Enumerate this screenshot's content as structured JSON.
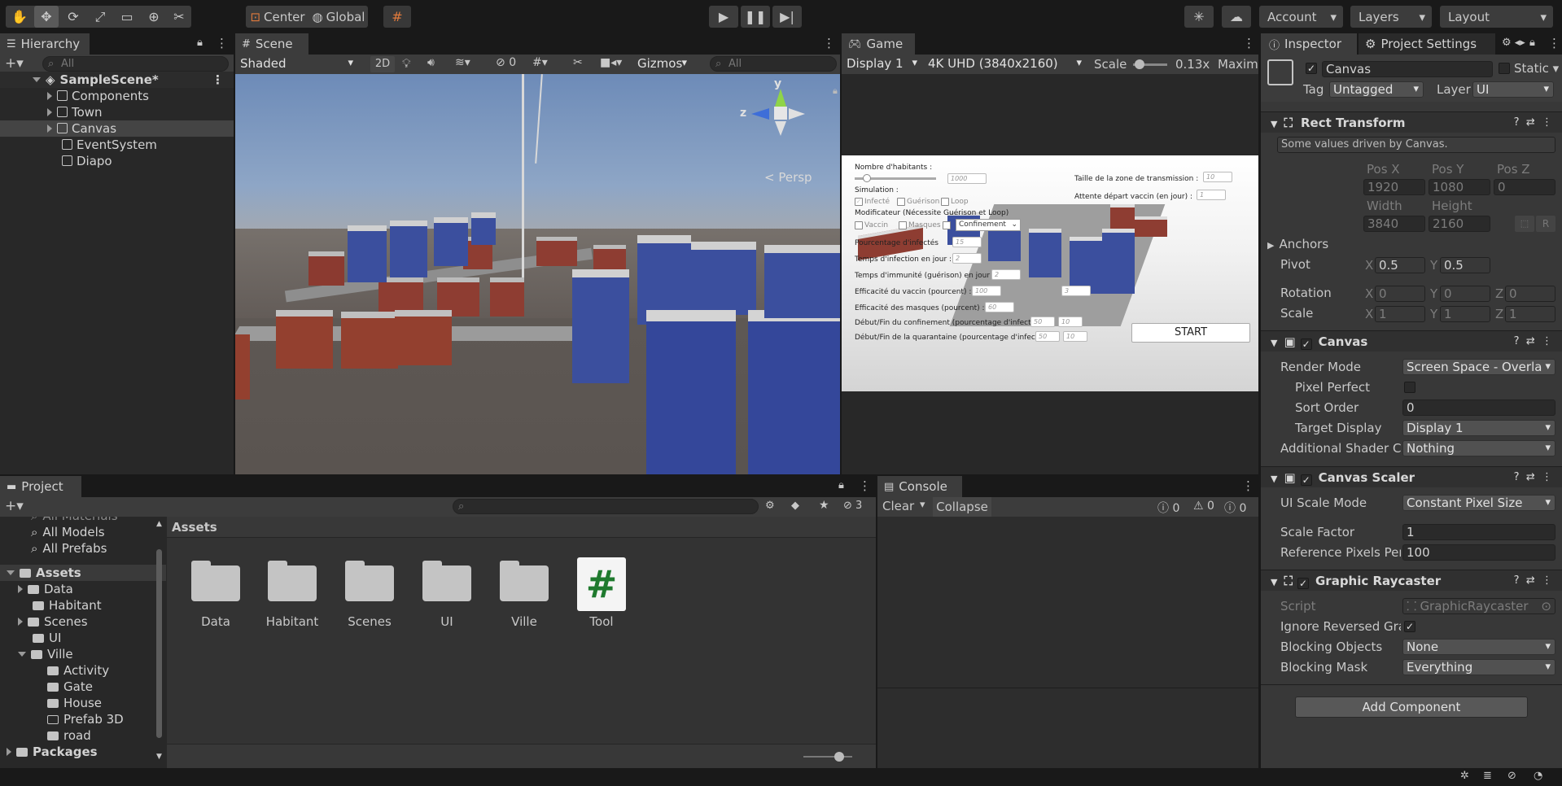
{
  "toolbar": {
    "center_label": "Center",
    "global_label": "Global",
    "account_label": "Account",
    "layers_label": "Layers",
    "layout_label": "Layout"
  },
  "hierarchy": {
    "tab_label": "Hierarchy",
    "search_placeholder": "All",
    "scene_name": "SampleScene*",
    "items": [
      {
        "label": "Components"
      },
      {
        "label": "Town"
      },
      {
        "label": "Canvas"
      },
      {
        "label": "EventSystem"
      },
      {
        "label": "Diapo"
      }
    ]
  },
  "scene": {
    "tab_label": "Scene",
    "shading": "Shaded",
    "mode_2d": "2D",
    "hidden_count": "0",
    "gizmos_label": "Gizmos",
    "search_placeholder": "All",
    "persp_label": "< Persp",
    "axis_y": "y",
    "axis_z": "z"
  },
  "game": {
    "tab_label": "Game",
    "display": "Display 1",
    "resolution": "4K UHD (3840x2160)",
    "scale_label": "Scale",
    "scale_value": "0.13x",
    "maximize_label": "Maximi",
    "ui": {
      "nb_habitants": "Nombre d'habitants :",
      "nb_value": "1000",
      "simulation": "Simulation :",
      "infecte": "Infecté",
      "guerison": "Guérison",
      "loop": "Loop",
      "modificateur": "Modificateur (Nécessite Guérison et Loop)",
      "vaccin": "Vaccin",
      "masques": "Masques",
      "confinement": "Confinement",
      "pourcentage": "Pourcentage d'infectés",
      "pourcentage_val": "15",
      "temps_infection": "Temps d'infection en jour :",
      "temps_infection_val": "2",
      "temps_immunite": "Temps d'immunité (guérison) en jour",
      "temps_immunite_val": "2",
      "efficacite_vaccin": "Efficacité du vaccin (pourcent) :",
      "efficacite_vaccin_val": "100",
      "efficacite_masques": "Efficacité des masques (pourcent) :",
      "efficacite_masques_val": "60",
      "confinement_label": "Début/Fin du confinement (pourcentage d'infecté) :",
      "confinement_debut": "50",
      "confinement_fin": "10",
      "quarantaine_label": "Début/Fin de la quarantaine (pourcentage d'infecté) :",
      "quarantaine_debut": "50",
      "quarantaine_fin": "10",
      "taille_zone": "Taille de la zone de transmission :",
      "taille_zone_val": "10",
      "attente_vaccin": "Attente départ vaccin (en jour) :",
      "attente_vaccin_val": "1",
      "extra_val": "3",
      "start": "START"
    }
  },
  "inspector": {
    "tab_label": "Inspector",
    "project_settings_label": "Project Settings",
    "object_name": "Canvas",
    "static_label": "Static",
    "tag_label": "Tag",
    "tag_value": "Untagged",
    "layer_label": "Layer",
    "layer_value": "UI",
    "rect_transform": {
      "title": "Rect Transform",
      "note": "Some values driven by Canvas.",
      "pos_x_label": "Pos X",
      "pos_x": "1920",
      "pos_y_label": "Pos Y",
      "pos_y": "1080",
      "pos_z_label": "Pos Z",
      "pos_z": "0",
      "width_label": "Width",
      "width": "3840",
      "height_label": "Height",
      "height": "2160",
      "r_label": "R",
      "anchors_label": "Anchors",
      "pivot_label": "Pivot",
      "pivot_x": "0.5",
      "pivot_y": "0.5",
      "rotation_label": "Rotation",
      "rot_x": "0",
      "rot_y": "0",
      "rot_z": "0",
      "scale_label": "Scale",
      "scale_x": "1",
      "scale_y": "1",
      "scale_z": "1",
      "x": "X",
      "y": "Y",
      "z": "Z"
    },
    "canvas": {
      "title": "Canvas",
      "render_mode_label": "Render Mode",
      "render_mode": "Screen Space - Overla",
      "pixel_perfect_label": "Pixel Perfect",
      "sort_order_label": "Sort Order",
      "sort_order": "0",
      "target_display_label": "Target Display",
      "target_display": "Display 1",
      "shader_label": "Additional Shader Ch",
      "shader_value": "Nothing"
    },
    "canvas_scaler": {
      "title": "Canvas Scaler",
      "ui_scale_mode_label": "UI Scale Mode",
      "ui_scale_mode": "Constant Pixel Size",
      "scale_factor_label": "Scale Factor",
      "scale_factor": "1",
      "ref_pixels_label": "Reference Pixels Per",
      "ref_pixels": "100"
    },
    "raycaster": {
      "title": "Graphic Raycaster",
      "script_label": "Script",
      "script_value": "GraphicRaycaster",
      "ignore_reversed_label": "Ignore Reversed Gra",
      "blocking_objects_label": "Blocking Objects",
      "blocking_objects": "None",
      "blocking_mask_label": "Blocking Mask",
      "blocking_mask": "Everything"
    },
    "add_component": "Add Component"
  },
  "project": {
    "tab_label": "Project",
    "hidden_count": "3",
    "assets_header": "Assets",
    "tree": [
      {
        "label": "All Materials"
      },
      {
        "label": "All Models"
      },
      {
        "label": "All Prefabs"
      },
      {
        "label": "Assets"
      },
      {
        "label": "Data"
      },
      {
        "label": "Habitant"
      },
      {
        "label": "Scenes"
      },
      {
        "label": "UI"
      },
      {
        "label": "Ville"
      },
      {
        "label": "Activity"
      },
      {
        "label": "Gate"
      },
      {
        "label": "House"
      },
      {
        "label": "Prefab 3D"
      },
      {
        "label": "road"
      },
      {
        "label": "Packages"
      }
    ],
    "grid": [
      {
        "label": "Data"
      },
      {
        "label": "Habitant"
      },
      {
        "label": "Scenes"
      },
      {
        "label": "UI"
      },
      {
        "label": "Ville"
      },
      {
        "label": "Tool"
      }
    ],
    "script_glyph": "#"
  },
  "console": {
    "tab_label": "Console",
    "clear_label": "Clear",
    "collapse_label": "Collapse",
    "info_count": "0",
    "warn_count": "0",
    "error_count": "0"
  }
}
